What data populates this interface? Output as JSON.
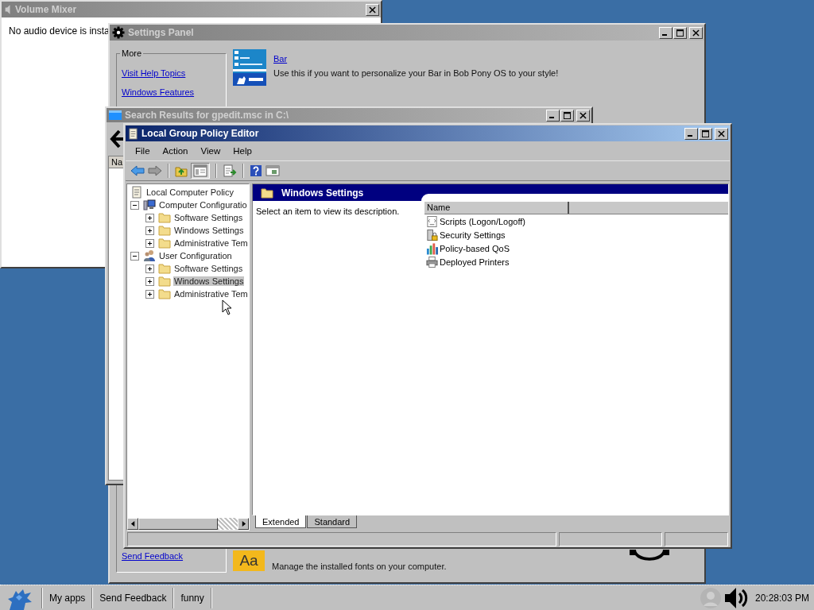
{
  "volume_mixer": {
    "title": "Volume Mixer",
    "message": "No audio device is insta"
  },
  "settings_panel": {
    "title": "Settings Panel",
    "group_label": "More",
    "links": [
      "Visit Help Topics",
      "Windows Features"
    ],
    "bottom_link": "Send Feedback",
    "items": [
      {
        "kind": "bar",
        "title": "Bar",
        "description": "Use this if you want to personalize your Bar in Bob Pony OS to your style!"
      },
      {
        "kind": "fonts",
        "icon_text": "Aa",
        "description": "Manage the installed fonts on your computer."
      }
    ]
  },
  "search_results": {
    "title": "Search Results for gpedit.msc in C:\\",
    "column_1": "Na"
  },
  "group_policy_editor": {
    "title": "Local Group Policy Editor",
    "menu": [
      "File",
      "Action",
      "View",
      "Help"
    ],
    "show_tree_pressed": true,
    "tree": [
      {
        "label": "Local Computer Policy",
        "kind": "policy",
        "selected": false,
        "children": [
          {
            "label": "Computer Configuratio",
            "kind": "computer",
            "expanded": true,
            "selected": false,
            "children": [
              {
                "label": "Software Settings",
                "kind": "folder",
                "expanded": false,
                "selected": false
              },
              {
                "label": "Windows Settings",
                "kind": "folder",
                "expanded": false,
                "selected": false
              },
              {
                "label": "Administrative Tem",
                "kind": "folder",
                "expanded": false,
                "selected": false
              }
            ]
          },
          {
            "label": "User Configuration",
            "kind": "users",
            "expanded": true,
            "selected": false,
            "children": [
              {
                "label": "Software Settings",
                "kind": "folder",
                "expanded": false,
                "selected": false
              },
              {
                "label": "Windows Settings",
                "kind": "folder",
                "expanded": false,
                "selected": true
              },
              {
                "label": "Administrative Tem",
                "kind": "folder",
                "expanded": false,
                "selected": false
              }
            ]
          }
        ]
      }
    ],
    "header": "Windows Settings",
    "description": "Select an item to view its description.",
    "columns": [
      "Name"
    ],
    "items": [
      {
        "label": "Scripts (Logon/Logoff)",
        "kind": "scripts"
      },
      {
        "label": "Security Settings",
        "kind": "security"
      },
      {
        "label": "Policy-based QoS",
        "kind": "qos"
      },
      {
        "label": "Deployed Printers",
        "kind": "printers"
      }
    ],
    "tabs": [
      {
        "label": "Extended",
        "selected": true
      },
      {
        "label": "Standard",
        "selected": false
      }
    ]
  },
  "taskbar": {
    "buttons": [
      "My apps",
      "Send Feedback",
      "funny"
    ],
    "clock": "20:28:03 PM"
  }
}
